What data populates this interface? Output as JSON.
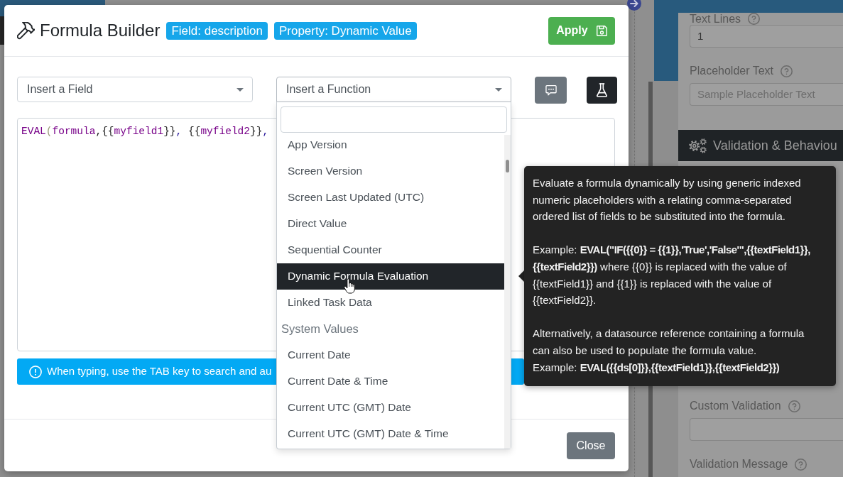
{
  "background": {
    "properties": {
      "fields": [
        {
          "label": "Text Lines",
          "kind": "input",
          "value": "1"
        },
        {
          "label": "Placeholder Text",
          "kind": "input",
          "placeholder": "Sample Placeholder Text"
        }
      ],
      "section": "Validation & Behaviou",
      "more_fields": [
        {
          "label": "Custom Validation",
          "kind": "input"
        },
        {
          "label": "Validation Message",
          "kind": "label"
        }
      ]
    }
  },
  "dialog": {
    "title": "Formula Builder",
    "badges": [
      "Field: description",
      "Property: Dynamic Value"
    ],
    "apply_button": "Apply",
    "selects": [
      {
        "label": "Insert a Field",
        "expanded": false
      },
      {
        "label": "Insert a Function",
        "expanded": true
      }
    ],
    "editor": {
      "tokens": [
        {
          "text": "EVAL",
          "kind": "name"
        },
        {
          "text": "(",
          "kind": "bracket"
        },
        {
          "text": "formula",
          "kind": "name"
        },
        {
          "text": ",{{",
          "kind": "plain"
        },
        {
          "text": "myfield1",
          "kind": "name"
        },
        {
          "text": "}}",
          "kind": "plain"
        },
        {
          "text": ",",
          "kind": "comma"
        },
        {
          "text": " {{",
          "kind": "plain"
        },
        {
          "text": "myfield2",
          "kind": "name"
        },
        {
          "text": "}}",
          "kind": "plain"
        },
        {
          "text": ",",
          "kind": "comma"
        }
      ]
    },
    "hint": "When typing, use the TAB key to search and au",
    "close_button": "Close"
  },
  "function_menu": {
    "sections": [
      {
        "options": [
          {
            "label": "App Version",
            "selected": false
          },
          {
            "label": "Screen Version",
            "selected": false
          },
          {
            "label": "Screen Last Updated (UTC)",
            "selected": false
          },
          {
            "label": "Direct Value",
            "selected": false
          },
          {
            "label": "Sequential Counter",
            "selected": false
          },
          {
            "label": "Dynamic Formula Evaluation",
            "selected": true
          },
          {
            "label": "Linked Task Data",
            "selected": false
          }
        ]
      },
      {
        "heading": "System Values",
        "options": [
          {
            "label": "Current Date",
            "selected": false
          },
          {
            "label": "Current Date & Time",
            "selected": false
          },
          {
            "label": "Current UTC (GMT) Date",
            "selected": false
          },
          {
            "label": "Current UTC (GMT) Date & Time",
            "selected": false
          }
        ]
      }
    ]
  },
  "tooltip": {
    "paragraphs": [
      [
        "Evaluate a formula dynamically by using generic indexed numeric placeholders with a relating comma-separated ordered list of fields to be substituted into the formula."
      ],
      [
        "Example: **EVAL(\"IF({{0}} = {{1}},'True','False'\",{{textField1}}, {{textField2}})** where {{0}} is replaced with the value of {{textField1}} and {{1}} is replaced with the value of {{textField2}}."
      ],
      [
        "Alternatively, a datasource reference containing a formula can also be used to populate the formula value.",
        "Example: **EVAL({{ds[0]}},{{textField1}},{{textField2}})**"
      ]
    ]
  }
}
